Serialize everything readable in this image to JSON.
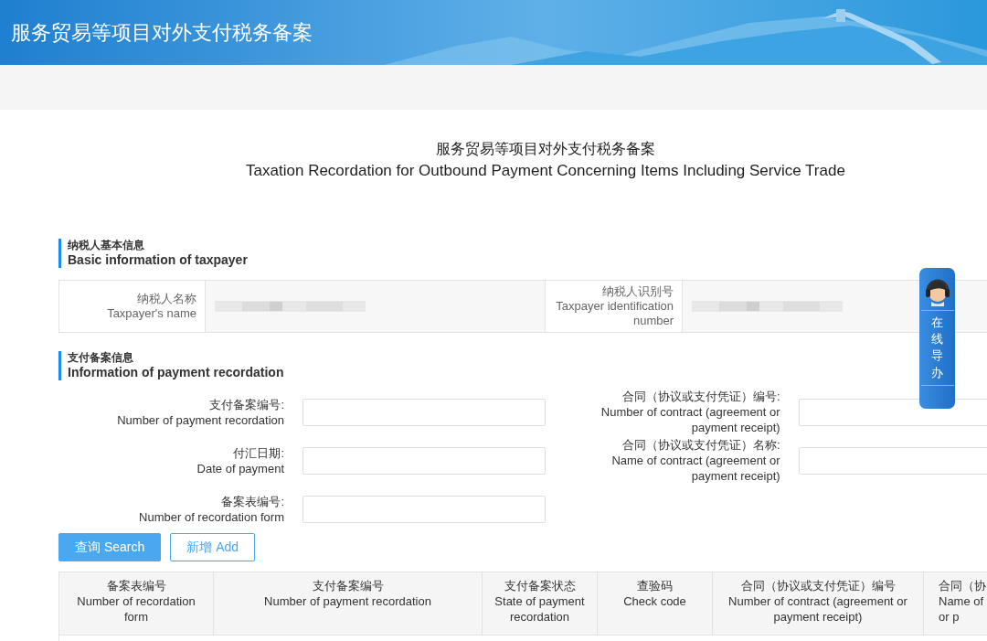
{
  "header": {
    "title": "服务贸易等项目对外支付税务备案"
  },
  "page_title": {
    "zh": "服务贸易等项目对外支付税务备案",
    "en": "Taxation Recordation for Outbound Payment Concerning Items Including Service Trade"
  },
  "taxpayer_section": {
    "zh": "纳税人基本信息",
    "en": "Basic information of taxpayer",
    "fields": [
      {
        "zh": "纳税人名称",
        "en": "Taxpayer's name"
      },
      {
        "zh": "纳税人识别号",
        "en": "Taxpayer identification number"
      }
    ]
  },
  "payment_section": {
    "zh": "支付备案信息",
    "en": "Information of payment recordation",
    "fields": [
      {
        "zh": "支付备案编号:",
        "en": "Number of payment recordation"
      },
      {
        "zh": "合同（协议或支付凭证）编号:",
        "en": "Number of contract (agreement or payment receipt)"
      },
      {
        "zh": "付汇日期:",
        "en": "Date of payment"
      },
      {
        "zh": "合同（协议或支付凭证）名称:",
        "en": "Name of contract (agreement or payment receipt)"
      },
      {
        "zh": "备案表编号:",
        "en": "Number of recordation form"
      }
    ]
  },
  "buttons": [
    {
      "label": "查询 Search",
      "kind": "primary"
    },
    {
      "label": "新增 Add",
      "kind": "outline"
    }
  ],
  "table": {
    "columns": [
      {
        "zh": "备案表编号",
        "en": "Number of recordation form"
      },
      {
        "zh": "支付备案编号",
        "en": "Number of payment recordation"
      },
      {
        "zh": "支付备案状态",
        "en": "State of payment recordation"
      },
      {
        "zh": "查验码",
        "en": "Check code"
      },
      {
        "zh": "合同（协议或支付凭证）编号",
        "en": "Number of contract (agreement or payment receipt)"
      },
      {
        "zh": "合同（协",
        "en": "Name of\nor p"
      }
    ]
  },
  "help_widget": {
    "label": "在线导办"
  }
}
